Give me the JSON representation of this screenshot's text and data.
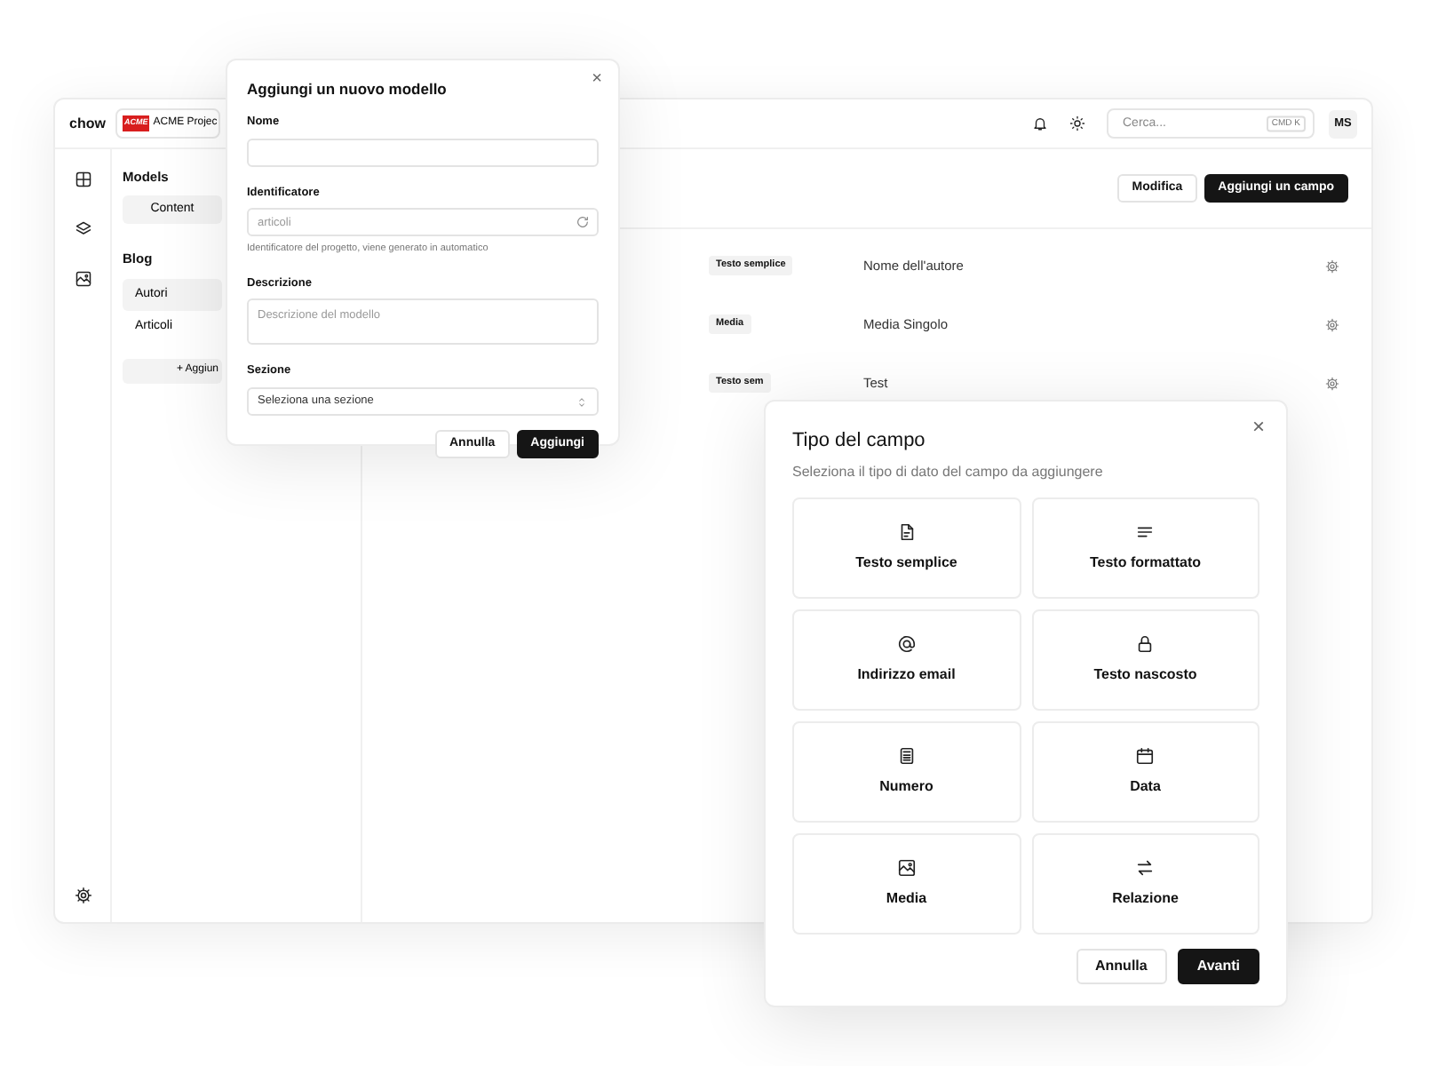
{
  "app": {
    "brand": "chow",
    "project": {
      "logo": "ACME",
      "name": "ACME Projec"
    }
  },
  "topbar": {
    "search": {
      "placeholder": "Cerca...",
      "shortcut": "CMD K"
    },
    "avatar": "MS"
  },
  "sidebar": {
    "title": "Models",
    "tabs": [
      {
        "label": "Content",
        "selected": true
      }
    ],
    "sections": [
      {
        "title": "Blog",
        "items": [
          {
            "label": "Autori",
            "selected": true
          },
          {
            "label": "Articoli",
            "selected": false
          }
        ]
      }
    ],
    "add_button": "+ Aggiun"
  },
  "toolbar": {
    "buttons": [
      {
        "label": "Modifica",
        "kind": "secondary"
      },
      {
        "label": "Aggiungi un campo",
        "kind": "primary"
      }
    ]
  },
  "fields": [
    {
      "type": "Testo semplice",
      "name": "Nome dell'autore"
    },
    {
      "type": "Media",
      "name": "Media Singolo"
    },
    {
      "type": "Testo sem",
      "name": "Test"
    }
  ],
  "new_model_dialog": {
    "title": "Aggiungi un nuovo modello",
    "close": "×",
    "fields": [
      {
        "kind": "text",
        "label": "Nome"
      },
      {
        "kind": "slug",
        "label": "Identificatore",
        "placeholder": "articoli",
        "help": "Identificatore del progetto, viene generato in automatico"
      },
      {
        "kind": "textarea",
        "label": "Descrizione",
        "placeholder": "Descrizione del modello"
      },
      {
        "kind": "select",
        "label": "Sezione",
        "value": "Seleziona una sezione"
      }
    ],
    "buttons": [
      {
        "label": "Annulla",
        "kind": "secondary"
      },
      {
        "label": "Aggiungi",
        "kind": "primary"
      }
    ]
  },
  "field_type_dialog": {
    "title": "Tipo del campo",
    "close": "×",
    "subtitle": "Seleziona il tipo di dato del campo da aggiungere",
    "options": [
      {
        "label": "Testo semplice"
      },
      {
        "label": "Testo formattato"
      },
      {
        "label": "Indirizzo email"
      },
      {
        "label": "Testo nascosto"
      },
      {
        "label": "Numero"
      },
      {
        "label": "Data"
      },
      {
        "label": "Media"
      },
      {
        "label": "Relazione"
      }
    ],
    "buttons": [
      {
        "label": "Annulla",
        "kind": "secondary"
      },
      {
        "label": "Avanti",
        "kind": "primary"
      }
    ]
  }
}
